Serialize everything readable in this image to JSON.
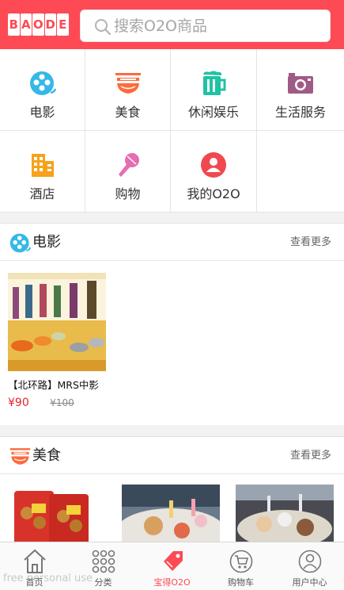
{
  "header": {
    "logo_letters": [
      "B",
      "A",
      "O",
      "D",
      "E"
    ],
    "search_placeholder": "搜索O2O商品"
  },
  "categories": [
    {
      "label": "电影",
      "icon": "film-reel-icon",
      "color": "#35b8e8"
    },
    {
      "label": "美食",
      "icon": "noodle-bowl-icon",
      "color": "#ff6a3d"
    },
    {
      "label": "休闲娱乐",
      "icon": "beer-mug-icon",
      "color": "#1fc3a3"
    },
    {
      "label": "生活服务",
      "icon": "camera-icon",
      "color": "#a15a86"
    },
    {
      "label": "酒店",
      "icon": "building-icon",
      "color": "#f7a21b"
    },
    {
      "label": "购物",
      "icon": "microphone-icon",
      "color": "#e56db1"
    },
    {
      "label": "我的O2O",
      "icon": "user-circle-icon",
      "color": "#f1484f"
    }
  ],
  "movie_section": {
    "title": "电影",
    "more": "查看更多",
    "item": {
      "name": "【北环路】MRS中影",
      "price": "¥90",
      "old_price": "¥100"
    }
  },
  "food_section": {
    "title": "美食",
    "more": "查看更多"
  },
  "tabbar": {
    "tabs": [
      {
        "label": "首页",
        "icon": "home-icon"
      },
      {
        "label": "分类",
        "icon": "grid-dots-icon"
      },
      {
        "label": "宝得O2O",
        "icon": "tag-icon",
        "active": true
      },
      {
        "label": "购物车",
        "icon": "cart-icon"
      },
      {
        "label": "用户中心",
        "icon": "user-icon"
      }
    ]
  },
  "watermark": "free personal use"
}
